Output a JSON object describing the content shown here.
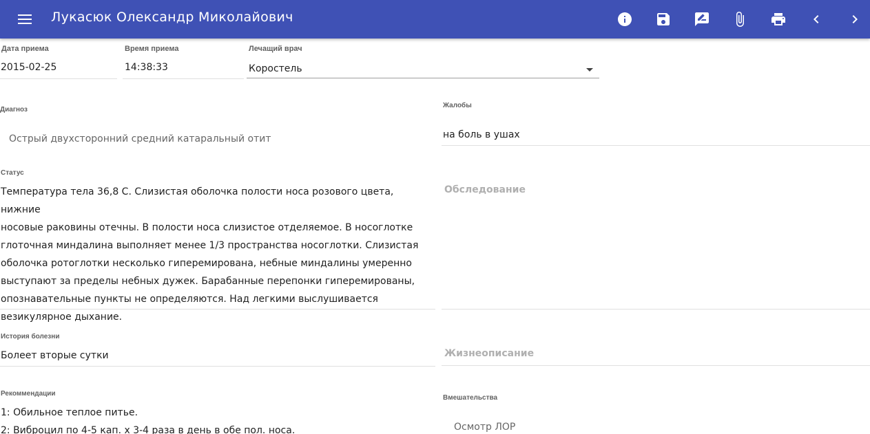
{
  "header": {
    "title": "Лукасюк Олександр Миколайович",
    "bg_color": "#3f51b5",
    "icons": [
      "menu-icon",
      "info-icon",
      "save-icon",
      "rate-review-icon",
      "attach-icon",
      "print-icon",
      "chevron-left-icon",
      "chevron-right-icon"
    ]
  },
  "visit": {
    "date_label": "Дата приема",
    "date_value": "2015-02-25",
    "time_label": "Время приема",
    "time_value": "14:38:33",
    "doctor_label": "Лечащий врач",
    "doctor_value": "Коростель"
  },
  "diagnosis": {
    "label": "Диагноз",
    "value": "Острый двухсторонний средний катаральный отит"
  },
  "complaints": {
    "label": "Жалобы",
    "value": "на боль в ушах"
  },
  "status": {
    "label": "Статус",
    "lines": [
      "Температура тела 36,8 С. Слизистая оболочка полости носа розового цвета, нижние",
      "носовые раковины отечны. В полости носа слизистое отделяемое. В носоглотке",
      "глоточная миндалина выполняет менее 1/3 пространства носоглотки. Слизистая",
      "оболочка ротоглотки несколько гиперемирована, небные миндалины умеренно",
      "выступают за пределы небных дужек. Барабанные перепонки гиперемированы,",
      "опознавательные пункты не определяются. Над легкими выслушивается",
      "везикулярное дыхание."
    ]
  },
  "examination": {
    "placeholder": "Обследование"
  },
  "history": {
    "label": "История болезни",
    "value": "Болеет вторые сутки"
  },
  "life_history": {
    "placeholder": "Жизнеописание"
  },
  "recommendations": {
    "label": "Рекоммендации",
    "lines": [
      "1: Обильное теплое питье.",
      "2: Виброцил по 4-5 кап. х 3-4 раза в день в обе пол. носа."
    ]
  },
  "interventions": {
    "label": "Вмешательства",
    "items": [
      "Осмотр ЛОР"
    ]
  }
}
